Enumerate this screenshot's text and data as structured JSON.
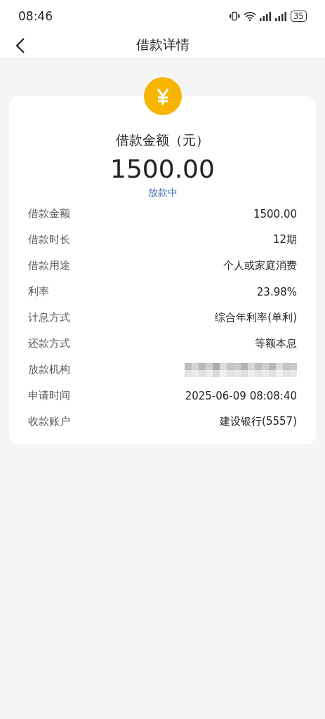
{
  "status_bar": {
    "time": "08:46",
    "battery": "35"
  },
  "header": {
    "title": "借款详情"
  },
  "summary": {
    "label": "借款金额（元）",
    "amount": "1500.00",
    "status": "放款中"
  },
  "details": [
    {
      "kind": "text",
      "label": "借款金额",
      "value": "1500.00"
    },
    {
      "kind": "text",
      "label": "借款时长",
      "value": "12期"
    },
    {
      "kind": "text",
      "label": "借款用途",
      "value": "个人或家庭消费"
    },
    {
      "kind": "text",
      "label": "利率",
      "value": "23.98%"
    },
    {
      "kind": "text",
      "label": "计息方式",
      "value": "综合年利率(单利)"
    },
    {
      "kind": "text",
      "label": "还款方式",
      "value": "等额本息"
    },
    {
      "kind": "redacted",
      "label": "放款机构"
    },
    {
      "kind": "text",
      "label": "申请时间",
      "value": "2025-06-09 08:08:40"
    },
    {
      "kind": "text",
      "label": "收款账户",
      "value": "建设银行(5557)"
    }
  ]
}
